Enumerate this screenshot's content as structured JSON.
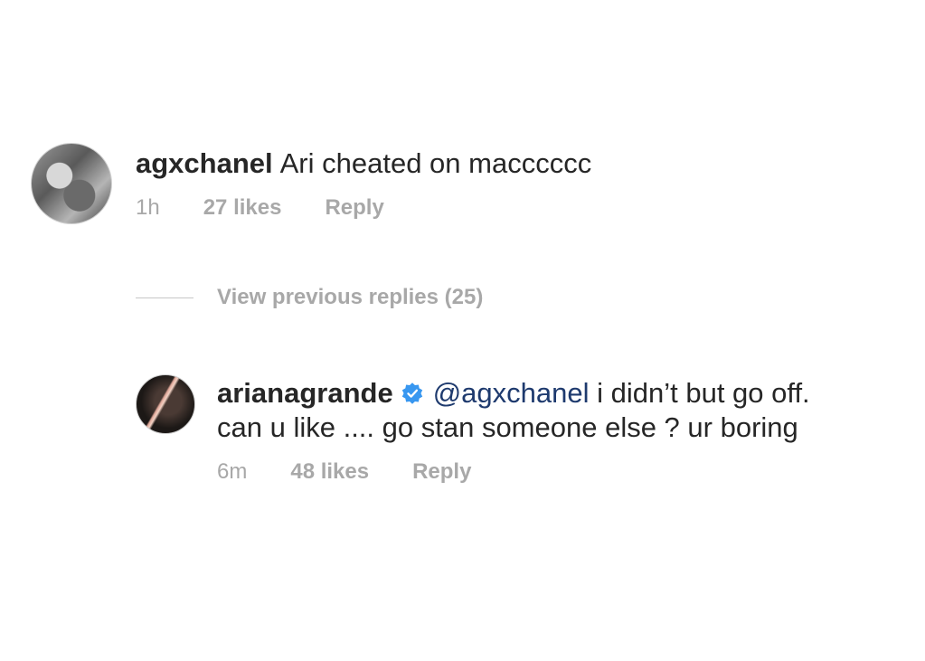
{
  "comments": [
    {
      "username": "agxchanel",
      "text": "Ari cheated on macccccc",
      "time": "1h",
      "likes": "27 likes",
      "reply_label": "Reply",
      "avatar_icon": "profile-photo"
    }
  ],
  "view_replies": {
    "label": "View previous replies (25)"
  },
  "reply": {
    "username": "arianagrande",
    "verified_icon": "verified-badge-icon",
    "mention": "@agxchanel",
    "text_line1": " i didn’t but go off.",
    "text_line2": "can u like .... go stan someone else ? ur boring",
    "time": "6m",
    "likes": "48 likes",
    "reply_label": "Reply",
    "avatar_icon": "profile-photo"
  },
  "colors": {
    "text": "#262626",
    "secondary": "#a8a8a8",
    "mention": "#1e3a6e",
    "verified": "#3897f0"
  }
}
